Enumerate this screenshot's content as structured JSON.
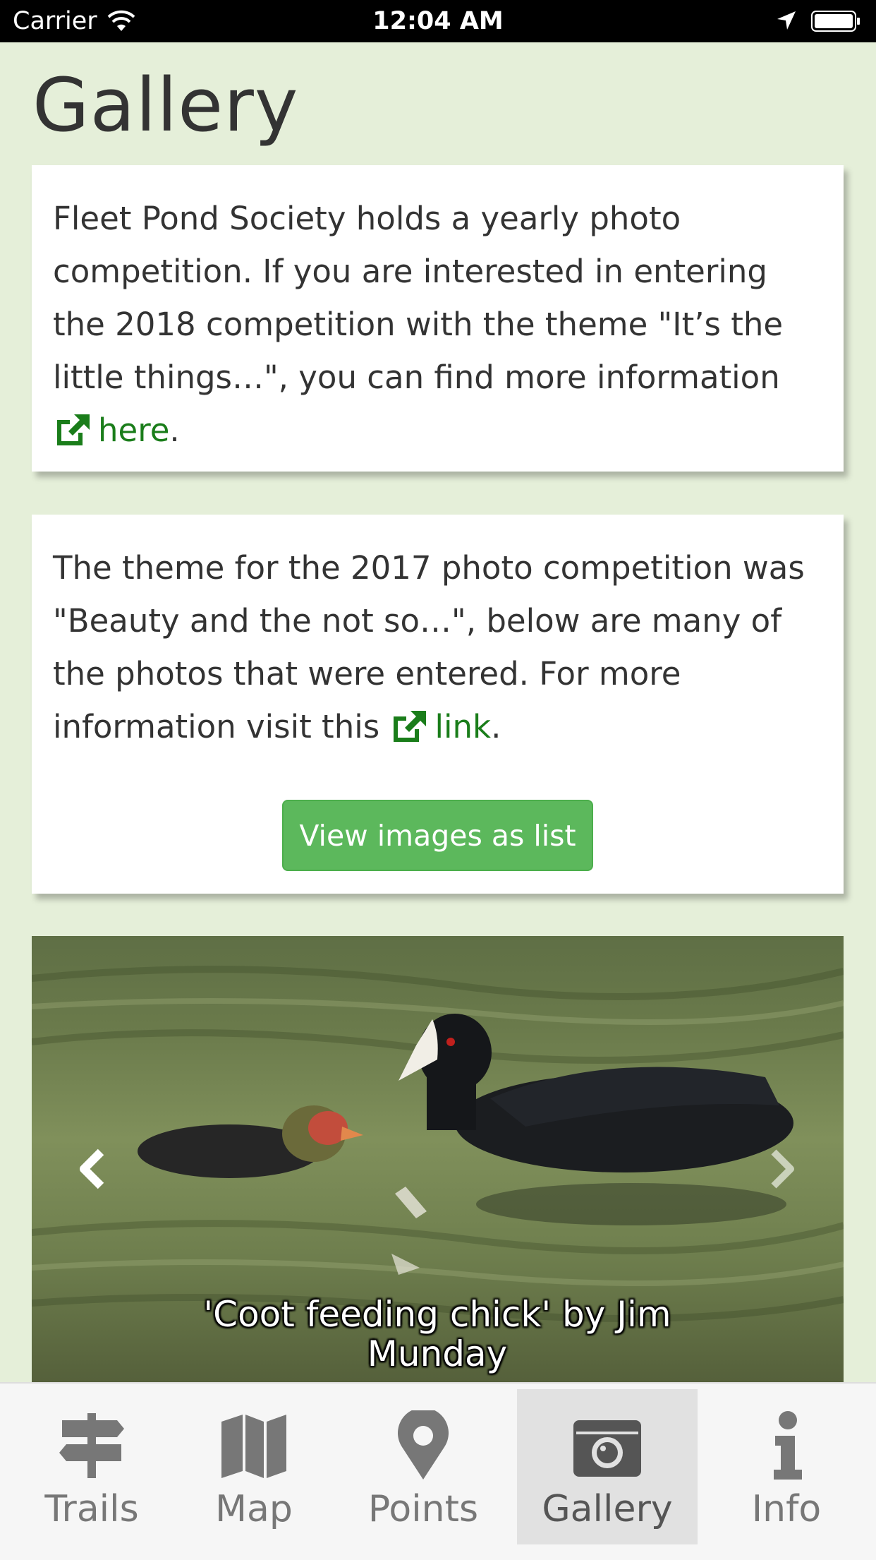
{
  "status_bar": {
    "carrier": "Carrier",
    "time": "12:04 AM"
  },
  "page": {
    "title": "Gallery"
  },
  "card1": {
    "text": "Fleet Pond Society holds a yearly photo competition. If you are interested in entering the 2018 competition with the theme \"It’s the little things…\", you can find more information ",
    "link_label": "here",
    "after_link": "."
  },
  "card2": {
    "text": "The theme for the 2017 photo competition was \"Beauty and the not so…\", below are many of the photos that were entered. For more information visit this ",
    "link_label": "link",
    "after_link": ".",
    "button_label": "View images as list"
  },
  "carousel": {
    "caption": "'Coot feeding chick' by Jim Munday"
  },
  "tabs": [
    {
      "label": "Trails",
      "icon": "signpost-icon"
    },
    {
      "label": "Map",
      "icon": "map-icon"
    },
    {
      "label": "Points",
      "icon": "map-pin-icon"
    },
    {
      "label": "Gallery",
      "icon": "camera-icon",
      "active": true
    },
    {
      "label": "Info",
      "icon": "info-icon"
    }
  ],
  "colors": {
    "background": "#e5efd9",
    "link": "#1a7d1a",
    "button": "#5cb85c",
    "active_tab": "#e1e1e1"
  }
}
